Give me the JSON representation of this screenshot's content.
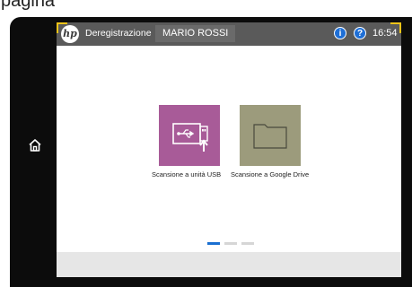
{
  "top_crop_text": "pagina",
  "device": {
    "home_icon": "home-icon"
  },
  "statusbar": {
    "logo": "hp",
    "deregister_label": "Deregistrazione",
    "user_name": "MARIO ROSSI",
    "info_label": "i",
    "help_label": "?",
    "time": "16:54"
  },
  "tiles": [
    {
      "label": "Scansione a unità USB",
      "icon": "usb-icon",
      "color": "#a85b98"
    },
    {
      "label": "Scansione a Google Drive",
      "icon": "folder-icon",
      "color": "#9c9b7c"
    }
  ],
  "pager": {
    "pages": 3,
    "current": 1
  }
}
